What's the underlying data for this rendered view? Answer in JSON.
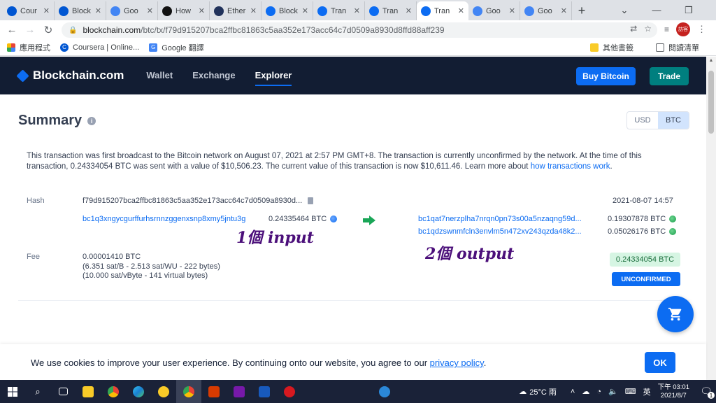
{
  "browser": {
    "tabs": [
      {
        "label": "Cour",
        "icon": "coursera-icon",
        "color": "#0056d2"
      },
      {
        "label": "Block",
        "icon": "blockchain-c-icon",
        "color": "#0056d2"
      },
      {
        "label": "Goo",
        "icon": "google-translate-icon",
        "color": "#4285f4"
      },
      {
        "label": "How",
        "icon": "medium-icon",
        "color": "#111111"
      },
      {
        "label": "Ether",
        "icon": "etherscan-icon",
        "color": "#21325b"
      },
      {
        "label": "Block",
        "icon": "blockchain-diamond-icon",
        "color": "#0c6cf2"
      },
      {
        "label": "Tran",
        "icon": "blockchain-diamond-icon",
        "color": "#0c6cf2"
      },
      {
        "label": "Tran",
        "icon": "blockchain-diamond-icon",
        "color": "#0c6cf2"
      },
      {
        "label": "Tran",
        "icon": "blockchain-diamond-icon",
        "color": "#0c6cf2"
      },
      {
        "label": "Goo",
        "icon": "google-translate-icon",
        "color": "#4285f4"
      },
      {
        "label": "Goo",
        "icon": "google-translate-icon",
        "color": "#4285f4"
      }
    ],
    "active_tab_index": 8,
    "new_tab_label": "+",
    "url_host": "blockchain.com",
    "url_path": "/btc/tx/f79d915207bca2ffbc81863c5aa352e173acc64c7d0509a8930d8ffd88aff239",
    "avatar_text": "訪客",
    "bookmarks": [
      {
        "label": "應用程式",
        "icon": "apps-grid-icon"
      },
      {
        "label": "Coursera | Online...",
        "icon": "coursera-icon"
      },
      {
        "label": "Google 翻譯",
        "icon": "google-translate-icon"
      }
    ],
    "bookmarks_right": [
      {
        "label": "其他書籤",
        "icon": "folder-icon"
      },
      {
        "label": "閱讀清單",
        "icon": "reading-list-icon"
      }
    ]
  },
  "site": {
    "logo": "Blockchain.com",
    "nav": [
      {
        "label": "Wallet",
        "active": false
      },
      {
        "label": "Exchange",
        "active": false
      },
      {
        "label": "Explorer",
        "active": true
      }
    ],
    "buy_label": "Buy Bitcoin",
    "trade_label": "Trade"
  },
  "summary": {
    "title": "Summary",
    "currency_options": [
      "USD",
      "BTC"
    ],
    "selected_currency": "BTC",
    "description_text": "This transaction was first broadcast to the Bitcoin network on August 07, 2021 at 2:57 PM GMT+8.  The transaction is currently unconfirmed by the network.  At the time of this transaction, 0.24334054 BTC was sent with a value of $10,506.23. The current value of this transaction is now $10,611.46.  Learn more about ",
    "description_link": "how transactions work",
    "description_end": ".",
    "hash_label": "Hash",
    "hash_value": "f79d915207bca2ffbc81863c5aa352e173acc64c7d0509a8930d...",
    "timestamp": "2021-08-07 14:57",
    "inputs": [
      {
        "address": "bc1q3xngycgurffurhsrnnzggenxsnp8xmy5jntu3g",
        "amount": "0.24335464 BTC"
      }
    ],
    "outputs": [
      {
        "address": "bc1qat7nerzplha7nrqn0pn73s00a5nzaqng59d...",
        "amount": "0.19307878 BTC"
      },
      {
        "address": "bc1qdzswnmfcln3envlm5n472xv243qzda48k2...",
        "amount": "0.05026176 BTC"
      }
    ],
    "fee_label": "Fee",
    "fee_lines": [
      "0.00001410 BTC",
      "(6.351 sat/B - 2.513 sat/WU - 222 bytes)",
      "(10.000 sat/vByte - 141 virtual bytes)"
    ],
    "total": "0.24334054 BTC",
    "status": "UNCONFIRMED"
  },
  "annotations": {
    "input_note": "1個 input",
    "output_note": "2個 output"
  },
  "cookie": {
    "text": "We use cookies to improve your user experience. By continuing onto our website, you agree to our ",
    "link": "privacy policy",
    "end": ".",
    "ok_label": "OK"
  },
  "taskbar": {
    "weather": "25°C 雨",
    "ime": "英",
    "time": "下午 03:01",
    "date": "2021/8/7",
    "notification_count": "1"
  },
  "colors": {
    "brand_blue": "#0c6cf2",
    "header_navy": "#121d33",
    "trade_teal": "#007f7f",
    "confirmed_green_bg": "#d6f5e3"
  }
}
